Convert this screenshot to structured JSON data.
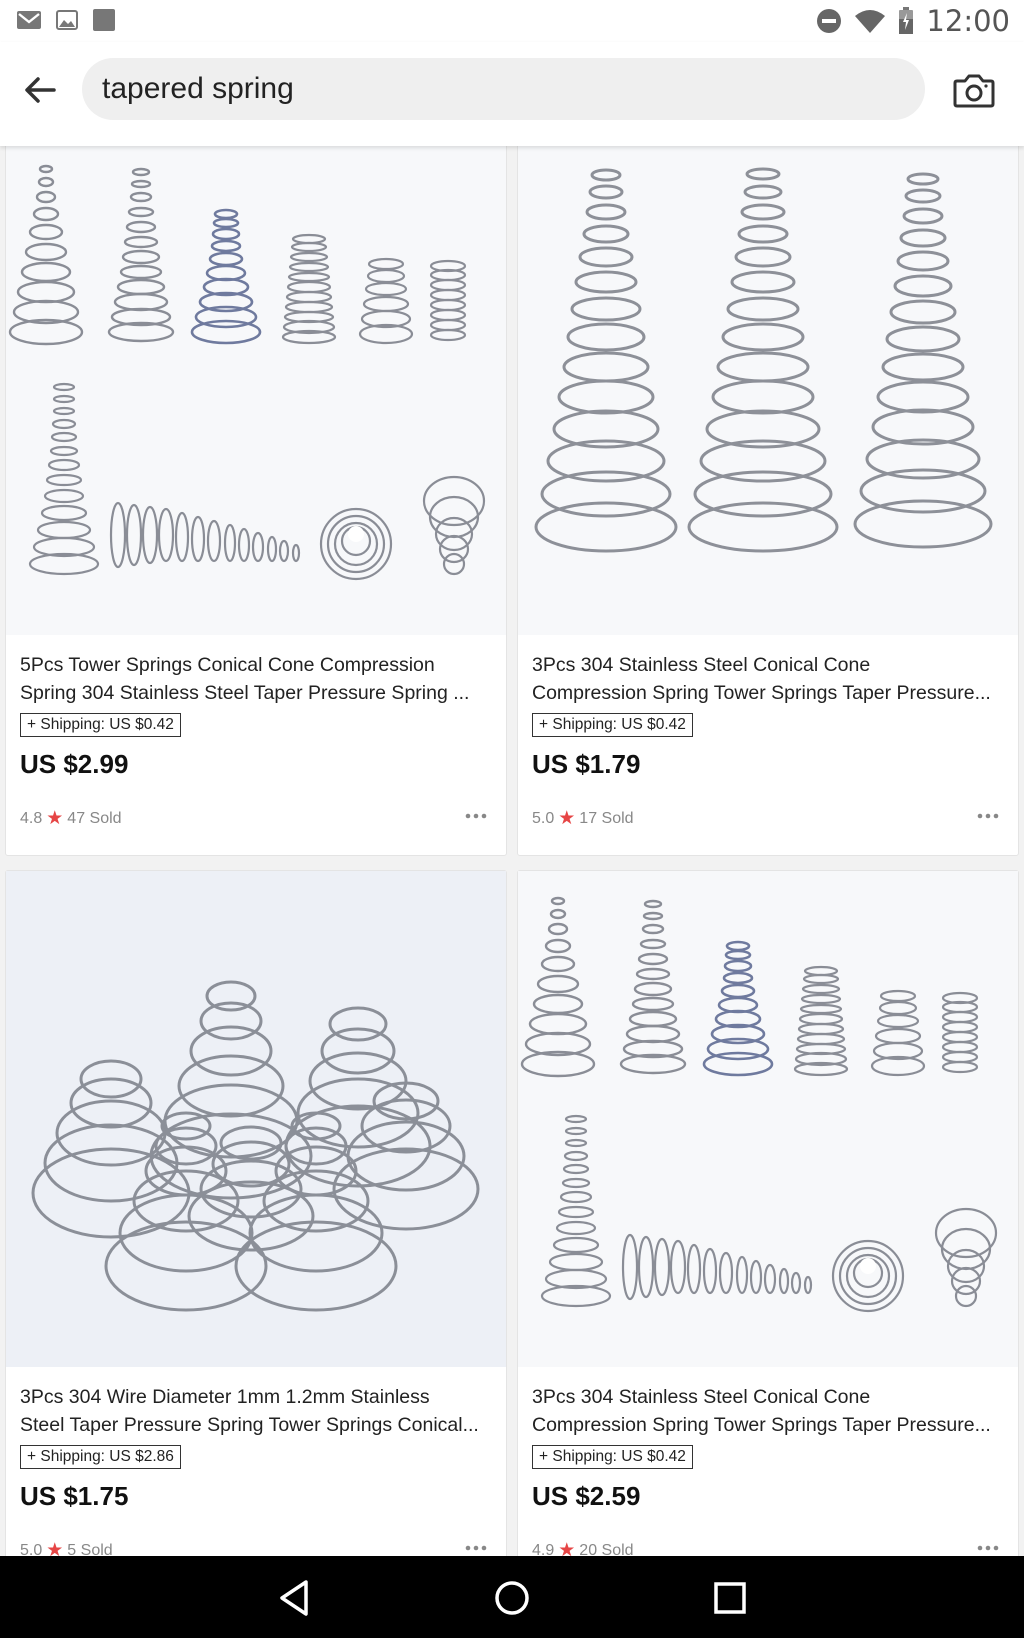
{
  "status_bar": {
    "time": "12:00",
    "left_icons": [
      "gmail-icon",
      "gallery-icon",
      "app-icon"
    ],
    "right_icons": [
      "dnd-icon",
      "wifi-icon",
      "battery-icon"
    ]
  },
  "search": {
    "query": "tapered spring",
    "back_icon": "arrow-left-icon",
    "camera_icon": "camera-icon"
  },
  "products": [
    {
      "title_line1": "5Pcs Tower Springs Conical Cone Compression",
      "title_line2": "Spring 304 Stainless Steel Taper Pressure Spring ...",
      "shipping": "+ Shipping: US $0.42",
      "price": "US $2.99",
      "rating": "4.8",
      "sold": "47 Sold"
    },
    {
      "title_line1": "3Pcs 304 Stainless Steel Conical Cone",
      "title_line2": "Compression Spring Tower Springs Taper Pressure...",
      "shipping": "+ Shipping: US $0.42",
      "price": "US $1.79",
      "rating": "5.0",
      "sold": "17 Sold"
    },
    {
      "title_line1": "3Pcs 304 Wire Diameter 1mm 1.2mm Stainless",
      "title_line2": "Steel Taper Pressure Spring Tower Springs Conical...",
      "shipping": "+ Shipping: US $2.86",
      "price": "US $1.75",
      "rating": "5.0",
      "sold": "5 Sold"
    },
    {
      "title_line1": "3Pcs 304 Stainless Steel Conical Cone",
      "title_line2": "Compression Spring Tower Springs Taper Pressure...",
      "shipping": "+ Shipping: US $0.42",
      "price": "US $2.59",
      "rating": "4.9",
      "sold": "20 Sold"
    }
  ],
  "nav_bar": {
    "icons": [
      "back-triangle-icon",
      "home-circle-icon",
      "recents-square-icon"
    ]
  },
  "colors": {
    "star": "#e64545",
    "background": "#f2f2f2",
    "nav_bar": "#000000"
  }
}
